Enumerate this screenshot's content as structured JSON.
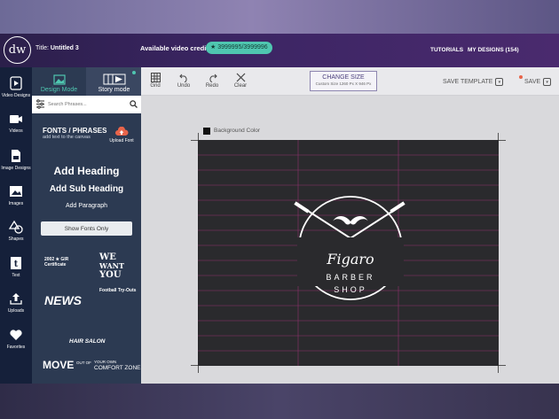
{
  "header": {
    "logo": "dw",
    "title_prefix": "Title:",
    "title_value": "Untitled 3",
    "credits_label": "Available video credits",
    "credits_value": "★ 3999995/3999996",
    "tutorials": "TUTORIALS",
    "my_designs": "MY DESIGNS (154)"
  },
  "sidebar": {
    "items": [
      {
        "label": "Video Designs",
        "icon": "video-designs-icon"
      },
      {
        "label": "Videos",
        "icon": "video-camera-icon"
      },
      {
        "label": "Image Designs",
        "icon": "image-designs-icon"
      },
      {
        "label": "Images",
        "icon": "image-icon"
      },
      {
        "label": "Shapes",
        "icon": "shapes-icon"
      },
      {
        "label": "Text",
        "icon": "text-icon"
      },
      {
        "label": "Uploads",
        "icon": "upload-icon"
      },
      {
        "label": "Favorites",
        "icon": "heart-icon"
      }
    ]
  },
  "panel": {
    "design_mode": "Design Mode",
    "story_mode": "Story mode",
    "search_placeholder": "Search Phrases...",
    "fonts_title": "FONTS / PHRASES",
    "fonts_sub": "add text to the canvas",
    "upload_font": "Upload Font",
    "add_heading": "Add Heading",
    "add_sub_heading": "Add Sub Heading",
    "add_paragraph": "Add Paragraph",
    "show_fonts_only": "Show Fonts Only",
    "samples": {
      "s1": "2002 ★ GIR Certificate",
      "s2a": "WE",
      "s2b": "WANT",
      "s2c": "YOU",
      "s3": "NEWS",
      "s4": "Football Try-Outs",
      "s5": "HAIR SALON",
      "s6": "MOVE",
      "s7": "COMFORT ZONE",
      "s8": "OUT OF",
      "s9": "YOUR OWN"
    }
  },
  "toolbar": {
    "grid": "Grid",
    "undo": "Undo",
    "redo": "Redo",
    "clear": "Clear",
    "change_size": "CHANGE SIZE",
    "custom_size": "Custom Size 1260 Px X 946 Px",
    "save_template": "SAVE TEMPLATE",
    "save": "SAVE"
  },
  "canvas": {
    "background_label": "Background Color",
    "background_color": "#2a2a2d",
    "guide_color": "#a3337a",
    "logo_script": "Figaro",
    "logo_line1": "BARBER",
    "logo_line2": "SHOP"
  },
  "colors": {
    "accent": "#4fc6b0",
    "topbar": "#3b2563",
    "nav": "#15203a",
    "panel": "#2c3a52"
  }
}
